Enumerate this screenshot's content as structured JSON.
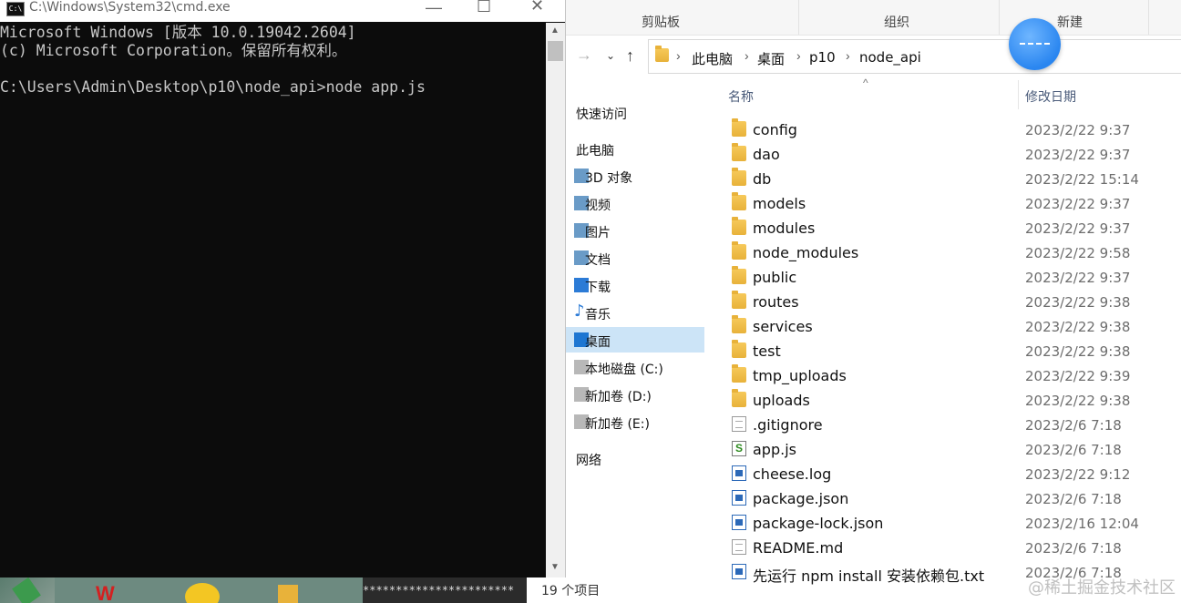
{
  "cmd": {
    "title": "C:\\Windows\\System32\\cmd.exe",
    "icon_text": "C:\\",
    "lines": [
      "Microsoft Windows [版本 10.0.19042.2604]",
      "(c) Microsoft Corporation。保留所有权利。",
      "",
      "C:\\Users\\Admin\\Desktop\\p10\\node_api>node app.js"
    ]
  },
  "ribbon": {
    "groups": [
      "剪贴板",
      "组织",
      "新建"
    ]
  },
  "address": {
    "crumbs": [
      "此电脑",
      "桌面",
      "p10",
      "node_api"
    ]
  },
  "nav_pane": {
    "items": [
      {
        "label": "快速访问",
        "icon": "star-icon",
        "selected": false
      },
      {
        "label": "此电脑",
        "icon": "computer-icon",
        "selected": false
      },
      {
        "label": "3D 对象",
        "icon": "cube-icon",
        "selected": false
      },
      {
        "label": "视频",
        "icon": "video-icon",
        "selected": false
      },
      {
        "label": "图片",
        "icon": "picture-icon",
        "selected": false
      },
      {
        "label": "文档",
        "icon": "document-icon",
        "selected": false
      },
      {
        "label": "下载",
        "icon": "download-icon",
        "selected": false
      },
      {
        "label": "音乐",
        "icon": "music-icon",
        "selected": false
      },
      {
        "label": "桌面",
        "icon": "desktop-icon",
        "selected": true
      },
      {
        "label": "本地磁盘 (C:)",
        "icon": "drive-icon",
        "selected": false
      },
      {
        "label": "新加卷 (D:)",
        "icon": "drive-icon",
        "selected": false
      },
      {
        "label": "新加卷 (E:)",
        "icon": "drive-icon",
        "selected": false
      },
      {
        "label": "网络",
        "icon": "network-icon",
        "selected": false
      }
    ]
  },
  "columns": {
    "name": "名称",
    "modified": "修改日期"
  },
  "files": [
    {
      "name": "config",
      "date": "2023/2/22 9:37",
      "type": "folder"
    },
    {
      "name": "dao",
      "date": "2023/2/22 9:37",
      "type": "folder"
    },
    {
      "name": "db",
      "date": "2023/2/22 15:14",
      "type": "folder"
    },
    {
      "name": "models",
      "date": "2023/2/22 9:37",
      "type": "folder"
    },
    {
      "name": "modules",
      "date": "2023/2/22 9:37",
      "type": "folder"
    },
    {
      "name": "node_modules",
      "date": "2023/2/22 9:58",
      "type": "folder"
    },
    {
      "name": "public",
      "date": "2023/2/22 9:37",
      "type": "folder"
    },
    {
      "name": "routes",
      "date": "2023/2/22 9:38",
      "type": "folder"
    },
    {
      "name": "services",
      "date": "2023/2/22 9:38",
      "type": "folder"
    },
    {
      "name": "test",
      "date": "2023/2/22 9:38",
      "type": "folder"
    },
    {
      "name": "tmp_uploads",
      "date": "2023/2/22 9:39",
      "type": "folder"
    },
    {
      "name": "uploads",
      "date": "2023/2/22 9:38",
      "type": "folder"
    },
    {
      "name": ".gitignore",
      "date": "2023/2/6 7:18",
      "type": "doc"
    },
    {
      "name": "app.js",
      "date": "2023/2/6 7:18",
      "type": "js"
    },
    {
      "name": "cheese.log",
      "date": "2023/2/22 9:12",
      "type": "blue"
    },
    {
      "name": "package.json",
      "date": "2023/2/6 7:18",
      "type": "blue"
    },
    {
      "name": "package-lock.json",
      "date": "2023/2/16 12:04",
      "type": "blue"
    },
    {
      "name": "README.md",
      "date": "2023/2/6 7:18",
      "type": "doc"
    },
    {
      "name": "先运行 npm install 安装依赖包.txt",
      "date": "2023/2/6 7:18",
      "type": "blue"
    }
  ],
  "status": {
    "count_text": "19 个项目"
  },
  "watermark": "@稀土掘金技术社区",
  "taskbar": {
    "dark_text": "***********************"
  }
}
